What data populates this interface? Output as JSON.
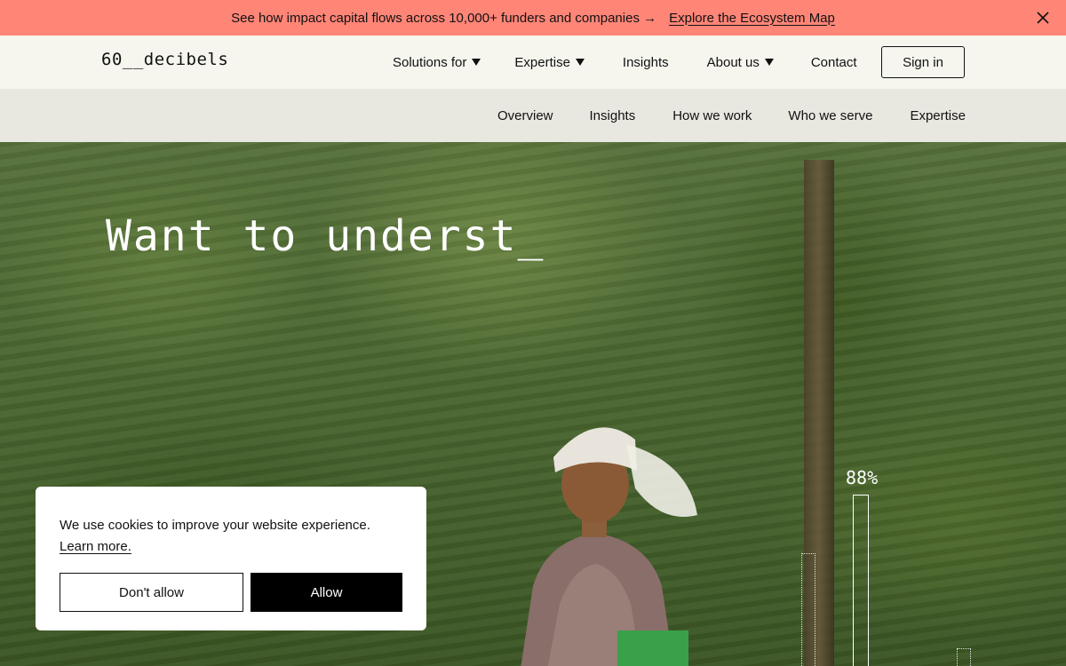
{
  "announcement": {
    "message": "See how impact capital flows across 10,000+ funders and companies →",
    "link_label": "Explore the Ecosystem Map",
    "close_icon": "close-icon",
    "background": "#ff8577"
  },
  "header": {
    "logo": "60__decibels",
    "nav": [
      {
        "label": "Solutions for",
        "has_dropdown": true
      },
      {
        "label": "Expertise",
        "has_dropdown": true
      },
      {
        "label": "Insights",
        "has_dropdown": false
      },
      {
        "label": "About us",
        "has_dropdown": true
      },
      {
        "label": "Contact",
        "has_dropdown": false
      }
    ],
    "signin_label": "Sign in"
  },
  "subnav": {
    "items": [
      "Overview",
      "Insights",
      "How we work",
      "Who we serve",
      "Expertise"
    ]
  },
  "hero": {
    "headline": "Want to underst_",
    "stat_label": "88%",
    "stat_value_percent": 88
  },
  "cookie": {
    "text": "We use cookies to improve your website experience.",
    "learn_more": "Learn more.",
    "deny_label": "Don't allow",
    "allow_label": "Allow"
  }
}
